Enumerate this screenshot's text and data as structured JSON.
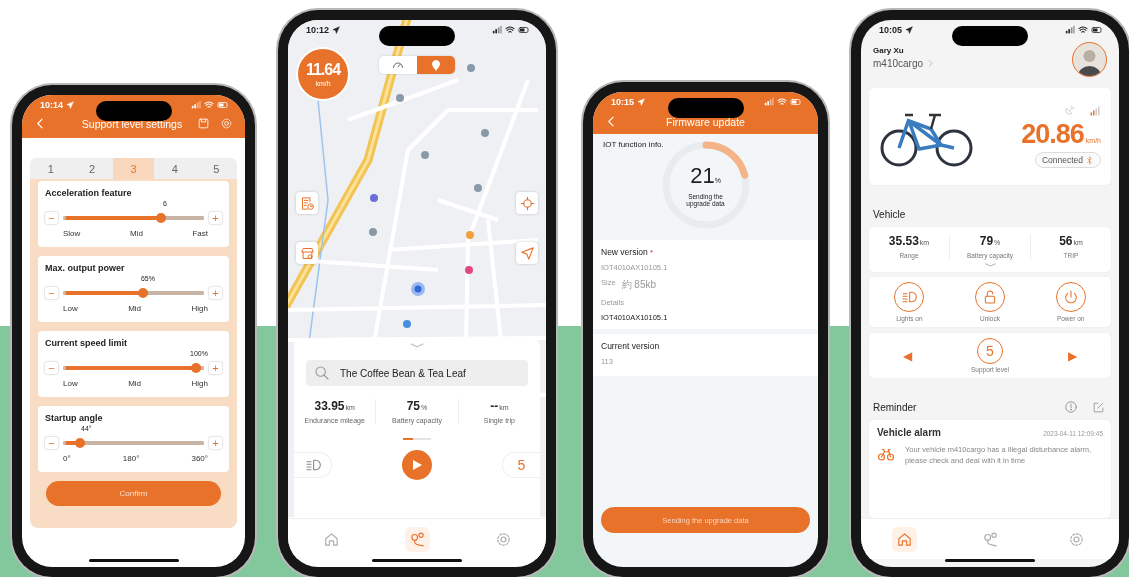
{
  "phones": [
    {
      "kind": "support_settings",
      "time": "10:14",
      "title": "Support level settings",
      "level_tabs": [
        {
          "label": "1",
          "selected": false
        },
        {
          "label": "2",
          "selected": false
        },
        {
          "label": "3",
          "selected": true
        },
        {
          "label": "4",
          "selected": false
        },
        {
          "label": "5",
          "selected": false
        }
      ],
      "settings": [
        {
          "title": "Acceleration feature",
          "reading": "6",
          "level": 0.74,
          "minus": "−",
          "plus": "+",
          "scale": [
            "Slow",
            "Mid",
            "Fast"
          ]
        },
        {
          "title": "Max. output power",
          "reading": "65%",
          "level": 0.61,
          "minus": "−",
          "plus": "+",
          "scale": [
            "Low",
            "Mid",
            "High"
          ]
        },
        {
          "title": "Current speed limit",
          "reading": "100%",
          "level": 1,
          "minus": "−",
          "plus": "+",
          "scale": [
            "Low",
            "Mid",
            "High"
          ]
        },
        {
          "title": "Startup angle",
          "reading": "44°",
          "level": 0.14,
          "minus": "−",
          "plus": "+",
          "scale": [
            "0°",
            "180°",
            "360°"
          ]
        }
      ],
      "confirm": "Confirm"
    },
    {
      "kind": "map",
      "time": "10:12",
      "speed": "11.64",
      "speed_unit": "km/h",
      "view_tabs": [
        {
          "selected": false
        },
        {
          "selected": true
        }
      ],
      "search": {
        "value": "The Coffee Bean & Tea Leaf"
      },
      "stats": [
        {
          "value": "33.95",
          "unit": "km",
          "label": "Endurance mileage"
        },
        {
          "value": "75",
          "unit": "%",
          "label": "Battery capacity"
        },
        {
          "value": "--",
          "unit": "km",
          "label": "Single trip"
        }
      ],
      "support_level": "5",
      "nav": [
        {
          "selected": false
        },
        {
          "selected": true
        },
        {
          "selected": false
        }
      ]
    },
    {
      "kind": "firmware",
      "time": "10:15",
      "title": "Firmware update",
      "section_label": "IOT function info.",
      "progress": {
        "level": 0.21,
        "percent": "21",
        "percent_sign": "%",
        "caption": "Sending the upgrade data"
      },
      "new_version": {
        "title": "New version",
        "required_mark": "*",
        "version": "IOT4010AX10105.1",
        "size_label": "Size",
        "size": "約 85kb",
        "details_label": "Details",
        "details": "IOT4010AX10105.1"
      },
      "current_version": {
        "title": "Current version",
        "version": "113"
      },
      "button": "Sending the upgrade data"
    },
    {
      "kind": "home",
      "time": "10:05",
      "user_name": "Gary Xu",
      "vehicle_name": "m410cargo",
      "speed": "20.86",
      "speed_unit": "km/h",
      "connection": "Connected",
      "vehicle_heading": "Vehicle",
      "stats": [
        {
          "value": "35.53",
          "unit": "km",
          "label": "Range"
        },
        {
          "value": "79",
          "unit": "%",
          "label": "Battery capacity"
        },
        {
          "value": "56",
          "unit": "km",
          "label": "TRIP"
        }
      ],
      "controls": [
        {
          "label": "Lights on"
        },
        {
          "label": "Unlock"
        },
        {
          "label": "Power on"
        }
      ],
      "support_level": {
        "prev": "◀",
        "value": "5",
        "next": "▶",
        "label": "Support level"
      },
      "reminder_heading": "Reminder",
      "alarm": {
        "title": "Vehicle alarm",
        "time": "2023-04-11 12:09:45",
        "message": "Your vehicle m410cargo has a Illegal disturbance alarm, please check and deal with it in time"
      },
      "nav": [
        {
          "selected": true
        },
        {
          "selected": false
        },
        {
          "selected": false
        }
      ]
    }
  ]
}
